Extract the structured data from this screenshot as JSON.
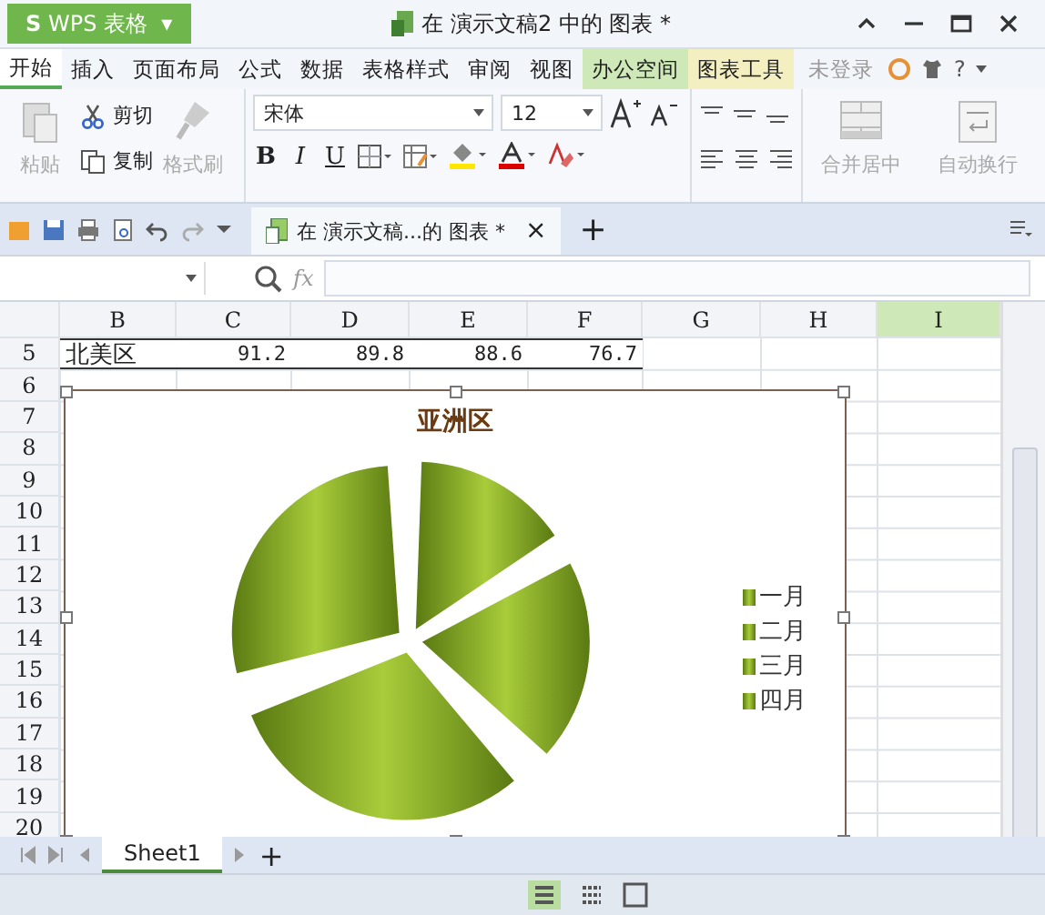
{
  "window": {
    "app_logo": "S",
    "app_name": "WPS 表格",
    "app_caret": "▾",
    "title": "在 演示文稿2 中的 图表 *"
  },
  "menu_tabs": [
    {
      "label": "开始",
      "selected": true
    },
    {
      "label": "插入",
      "selected": false
    },
    {
      "label": "页面布局",
      "selected": false
    },
    {
      "label": "公式",
      "selected": false
    },
    {
      "label": "数据",
      "selected": false
    },
    {
      "label": "表格样式",
      "selected": false
    },
    {
      "label": "审阅",
      "selected": false
    },
    {
      "label": "视图",
      "selected": false
    },
    {
      "label": "办公空间",
      "selected": false,
      "color": "#cfe8b8"
    },
    {
      "label": "图表工具",
      "selected": false,
      "color": "#f3efc0"
    }
  ],
  "account": "未登录",
  "help": "?",
  "ribbon": {
    "paste": {
      "label": "粘贴",
      "disabled": true
    },
    "cut": {
      "label": "剪切",
      "disabled": false
    },
    "copy": {
      "label": "复制",
      "disabled": false
    },
    "format_painter": {
      "label": "格式刷",
      "disabled": true
    },
    "font": "宋体",
    "font_size": "12",
    "bold": "B",
    "italic": "I",
    "underline": "U",
    "merge": {
      "label": "合并居中",
      "disabled": true
    },
    "wrap": {
      "label": "自动换行",
      "disabled": true
    }
  },
  "doc_tab": {
    "label": "在 演示文稿...的 图表 *",
    "close": "×",
    "new": "+"
  },
  "formula_bar": {
    "fx": "fx"
  },
  "columns": [
    {
      "label": "B",
      "selected": false
    },
    {
      "label": "C",
      "selected": false
    },
    {
      "label": "D",
      "selected": false
    },
    {
      "label": "E",
      "selected": false
    },
    {
      "label": "F",
      "selected": false
    },
    {
      "label": "G",
      "selected": false
    },
    {
      "label": "H",
      "selected": false
    },
    {
      "label": "I",
      "selected": true
    }
  ],
  "data_row": {
    "number": "5",
    "cells": [
      "北美区",
      "91.2",
      "89.8",
      "88.6",
      "76.7"
    ]
  },
  "row_numbers": [
    "6",
    "7",
    "8",
    "9",
    "10",
    "11",
    "12",
    "13",
    "14",
    "15",
    "16",
    "17",
    "18",
    "19",
    "20"
  ],
  "chart": {
    "title": "亚洲区",
    "legend": [
      "一月",
      "二月",
      "三月",
      "四月"
    ]
  },
  "sheet_tabs": [
    {
      "label": "Sheet1",
      "selected": true
    }
  ],
  "sheet_add": "+"
}
